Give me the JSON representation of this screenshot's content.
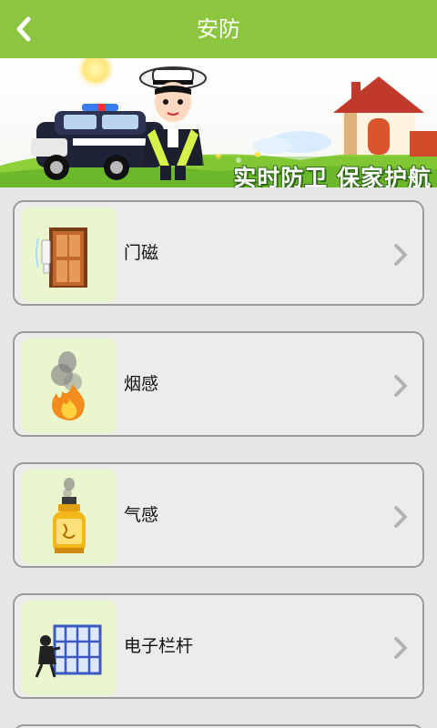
{
  "header": {
    "title": "安防",
    "back_icon": "chevron-left-icon",
    "background_color": "#8cc63f"
  },
  "banner": {
    "slogan": "实时防卫 保家护航"
  },
  "items": [
    {
      "label": "门磁",
      "icon": "door-sensor-icon"
    },
    {
      "label": "烟感",
      "icon": "smoke-fire-icon"
    },
    {
      "label": "气感",
      "icon": "gas-cylinder-icon"
    },
    {
      "label": "电子栏杆",
      "icon": "electronic-fence-icon"
    }
  ],
  "colors": {
    "card_border": "#9b9b9b",
    "thumb_background": "#eaf6cd",
    "chevron": "#b3b3b3"
  }
}
